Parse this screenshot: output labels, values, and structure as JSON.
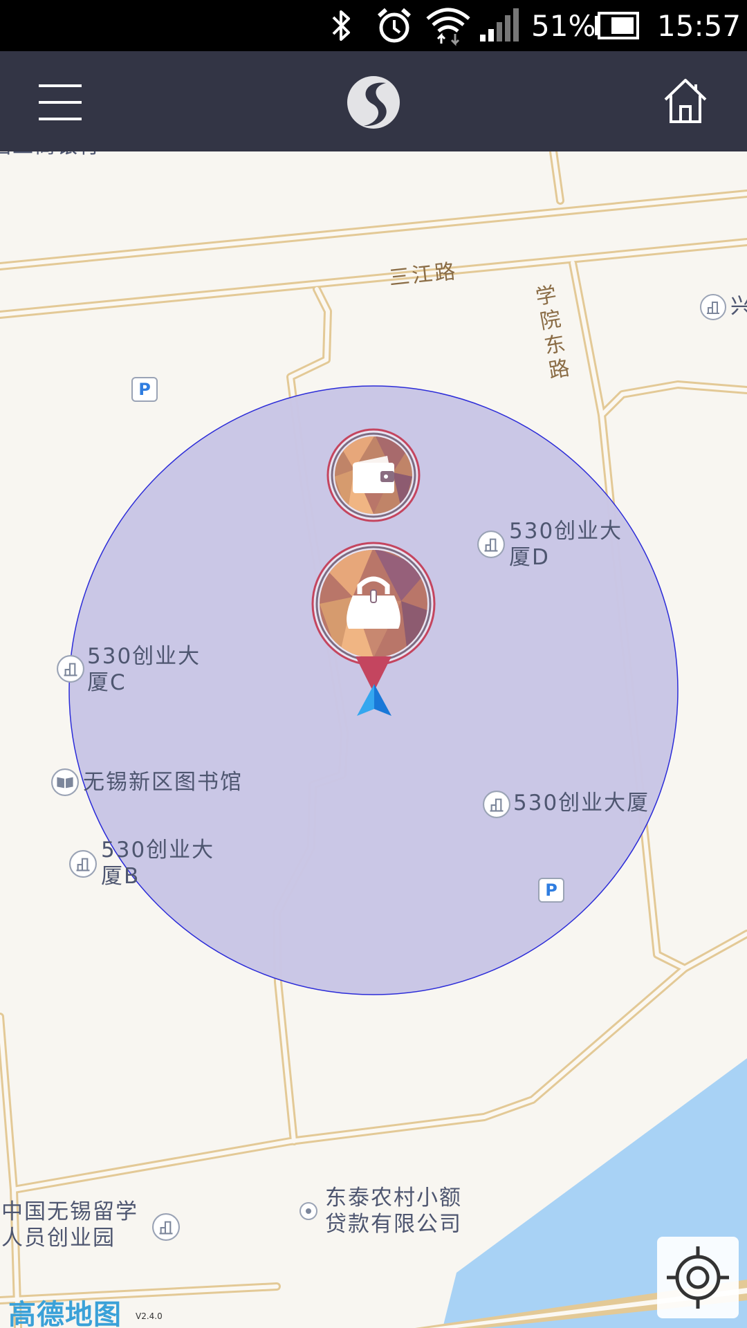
{
  "status_bar": {
    "battery_percent": "51%",
    "time": "15:57",
    "icons": [
      "bluetooth-icon",
      "alarm-icon",
      "wifi-icon",
      "signal-icon",
      "battery-icon"
    ]
  },
  "app_bar": {
    "menu_icon": "hamburger-menu-icon",
    "logo_icon": "app-logo-icon",
    "home_icon": "home-icon"
  },
  "map": {
    "road_labels": {
      "sanjiang": "三江路",
      "xueyuan_east": "学院东路"
    },
    "pois": {
      "icbc": "国工商银行",
      "xing_partial": "兴",
      "bldg_d": "530创业大\n厦D",
      "bldg_c": "530创业大\n厦C",
      "library": "无锡新区图书馆",
      "bldg_main": "530创业大厦",
      "bldg_b": "530创业大\n厦B",
      "overseas_park": "中国无锡留学\n人员创业园",
      "dongtai": "东泰农村小额\n贷款有限公司"
    },
    "parking_label": "P",
    "geofence_color": "#c9c6e6",
    "markers": [
      "wallet-marker",
      "handbag-marker",
      "navigation-arrow"
    ],
    "brand": "高德地图",
    "version": "V2.4.0",
    "locate_icon": "locate-crosshair-icon"
  }
}
